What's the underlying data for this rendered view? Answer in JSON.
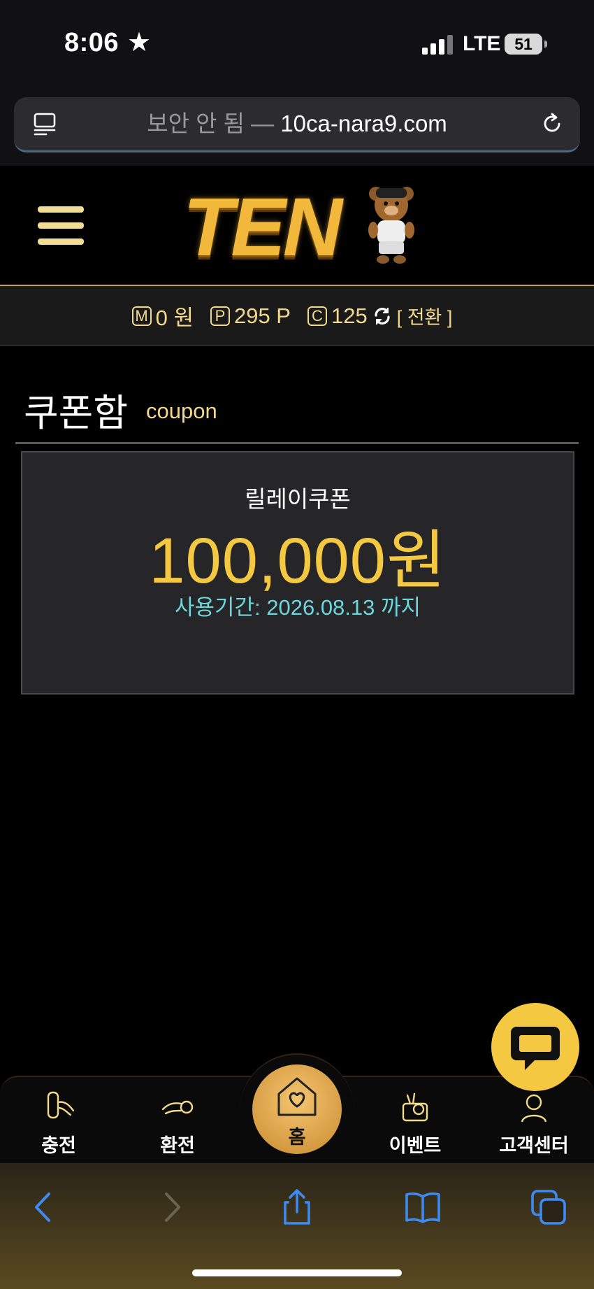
{
  "status_bar": {
    "time": "8:06",
    "network": "LTE",
    "battery": "51"
  },
  "browser": {
    "url_prefix": "보안 안 됨 —",
    "url_domain": "10ca-nara9.com"
  },
  "header": {
    "logo_text": "TEN"
  },
  "balance": {
    "money_icon": "M",
    "money": "0 원",
    "point_icon": "P",
    "points": "295 P",
    "coin_icon": "C",
    "coins": "125",
    "switch_label": "[ 전환 ]"
  },
  "page": {
    "title": "쿠폰함",
    "subtitle": "coupon"
  },
  "coupon": {
    "name": "릴레이쿠폰",
    "amount": "100,000원",
    "expiry": "사용기간: 2026.08.13 까지"
  },
  "bottom_nav": {
    "charge": "충전",
    "exchange": "환전",
    "home": "홈",
    "event": "이벤트",
    "support": "고객센터"
  },
  "colors": {
    "accent_gold": "#f5c842",
    "light_gold": "#f3d98a",
    "expiry_cyan": "#6fd6dc",
    "safari_blue": "#3d8bf2"
  }
}
